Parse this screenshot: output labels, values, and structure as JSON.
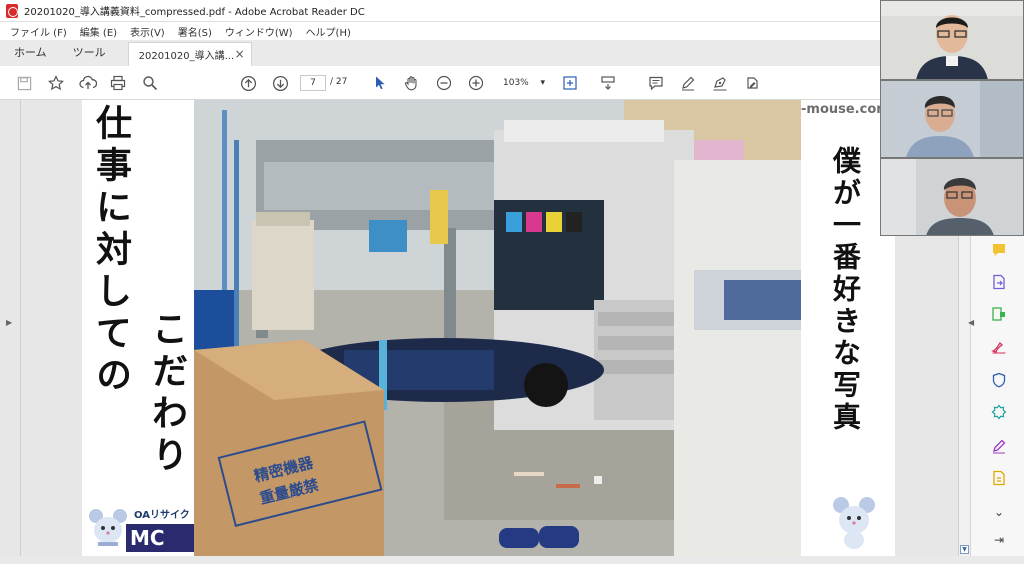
{
  "window": {
    "title": "20201020_導入講義資料_compressed.pdf - Adobe Acrobat Reader DC"
  },
  "menu": [
    "ファイル (F)",
    "編集 (E)",
    "表示(V)",
    "署名(S)",
    "ウィンドウ(W)",
    "ヘルプ(H)"
  ],
  "tabs": {
    "home": "ホーム",
    "tools": "ツール",
    "document": "20201020_導入講...",
    "close": "×"
  },
  "toolbar": {
    "page_current": "7",
    "page_total": "/ 27",
    "zoom": "103%"
  },
  "icons": [
    "save-icon",
    "star-icon",
    "upload-cloud-icon",
    "print-icon",
    "search-icon",
    "page-up-icon",
    "page-down-icon",
    "cursor-icon",
    "hand-icon",
    "zoom-out-icon",
    "zoom-in-icon",
    "fit-page-icon",
    "scroll-mode-icon",
    "comment-icon",
    "highlight-pen-icon",
    "sign-icon",
    "fill-sign-icon"
  ],
  "slide": {
    "left_title": "仕事に対しての",
    "left_sub": "こだわり",
    "right_title": "僕が一番好きな写真",
    "url": "-mouse.com",
    "logo_line": "OAリサイク",
    "logo_mark": "MC",
    "box_label_1": "精密機器",
    "box_label_2": "重量厳禁"
  },
  "right_panel_icons": [
    "comment-tool-icon",
    "export-pdf-icon",
    "edit-pdf-icon",
    "sign-tool-icon",
    "protect-icon",
    "enhance-icon",
    "fill-sign-tool-icon",
    "more-tools-icon",
    "expand-chevron-icon",
    "collapse-panel-icon"
  ],
  "colors": {
    "acrobat_red": "#d82b2b",
    "accent_blue": "#2a5fb3",
    "photo_floor": "#b3b2ab"
  }
}
